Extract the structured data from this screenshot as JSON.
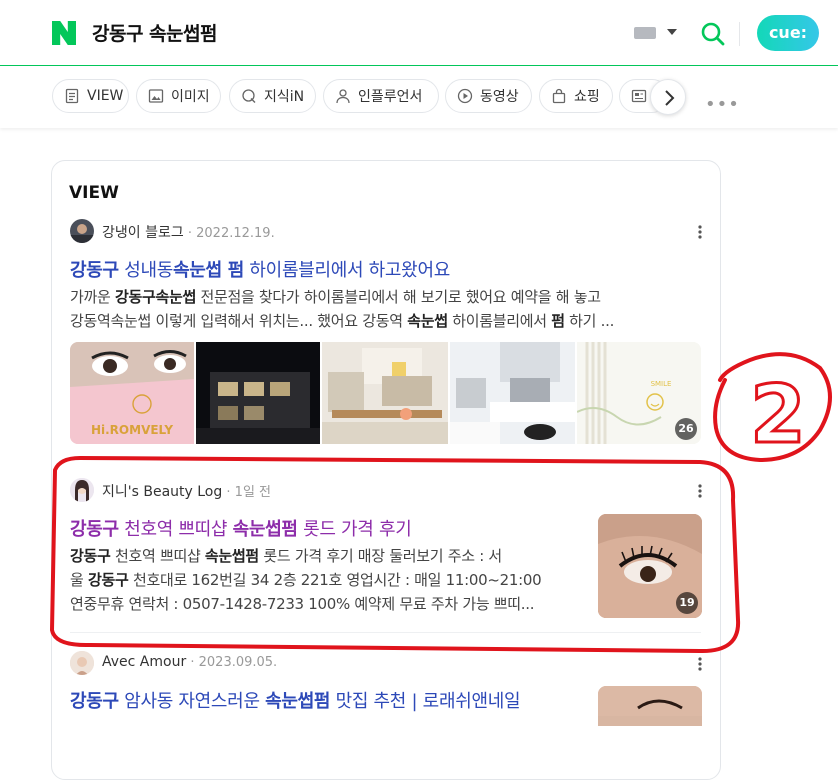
{
  "header": {
    "query": "강동구 속눈썹펌"
  },
  "tabs": [
    {
      "label": "VIEW"
    },
    {
      "label": "이미지"
    },
    {
      "label": "지식iN"
    },
    {
      "label": "인플루언서"
    },
    {
      "label": "동영상"
    },
    {
      "label": "쇼핑"
    },
    {
      "label": "뉴스"
    }
  ],
  "section": {
    "title": "VIEW"
  },
  "posts": [
    {
      "author": "강냉이 블로그",
      "date": "2022.12.19.",
      "title": {
        "p1": "강동구",
        "p2": " 성내동",
        "p3": "속눈썹 펌",
        "p4": " 하이롬블리에서 하고왔어요"
      },
      "snippet1": {
        "p1": "가까운 ",
        "p2": "강동구속눈썹",
        "p3": " 전문점을 찾다가 하이롬블리에서 해 보기로 했어요 예약을 해 놓고"
      },
      "snippet2": {
        "p1": "강동역속눈썹",
        "p2": " 이렇게 입력해서 위치는... 했어요 강동역 ",
        "p3": "속눈썹",
        "p4": " 하이롬블리에서 ",
        "p5": "펌",
        "p6": " 하기 ..."
      },
      "sign_text": "Hi.ROMVELY",
      "image_count": "26"
    },
    {
      "author": "지니's Beauty Log",
      "date": "1일 전",
      "title": {
        "p1": "강동구",
        "p2": " 천호역 쁘띠샵 ",
        "p3": "속눈썹펌",
        "p4": " 롯드 가격 후기"
      },
      "snippet1": {
        "p1": "강동구",
        "p2": " 천호역 쁘띠샵 ",
        "p3": "속눈썹펌",
        "p4": " 롯드 가격 후기 매장 둘러보기 주소 : 서"
      },
      "snippet2": {
        "p1": "울 ",
        "p2": "강동구",
        "p3": " 천호대로 162번길 34 2층 221호 영업시간 : 매일 11:00~21:00"
      },
      "snippet3": "연중무휴 연락처 : 0507-1428-7233 100% 예약제 무료 주차 가능 쁘띠...",
      "image_count": "19"
    },
    {
      "author": "Avec Amour",
      "date": "2023.09.05.",
      "title": {
        "p1": "강동구",
        "p2": " 암사동 자연스러운 ",
        "p3": "속눈썹펌",
        "p4": " 맛집 추천 | 로래쉬앤네일"
      }
    }
  ],
  "annotation": {
    "label": "2"
  },
  "colors": {
    "naver_green": "#03c75a",
    "link_blue": "#2d49b8",
    "visited_purple": "#8d2daa",
    "annotation_red": "#e0141c"
  }
}
